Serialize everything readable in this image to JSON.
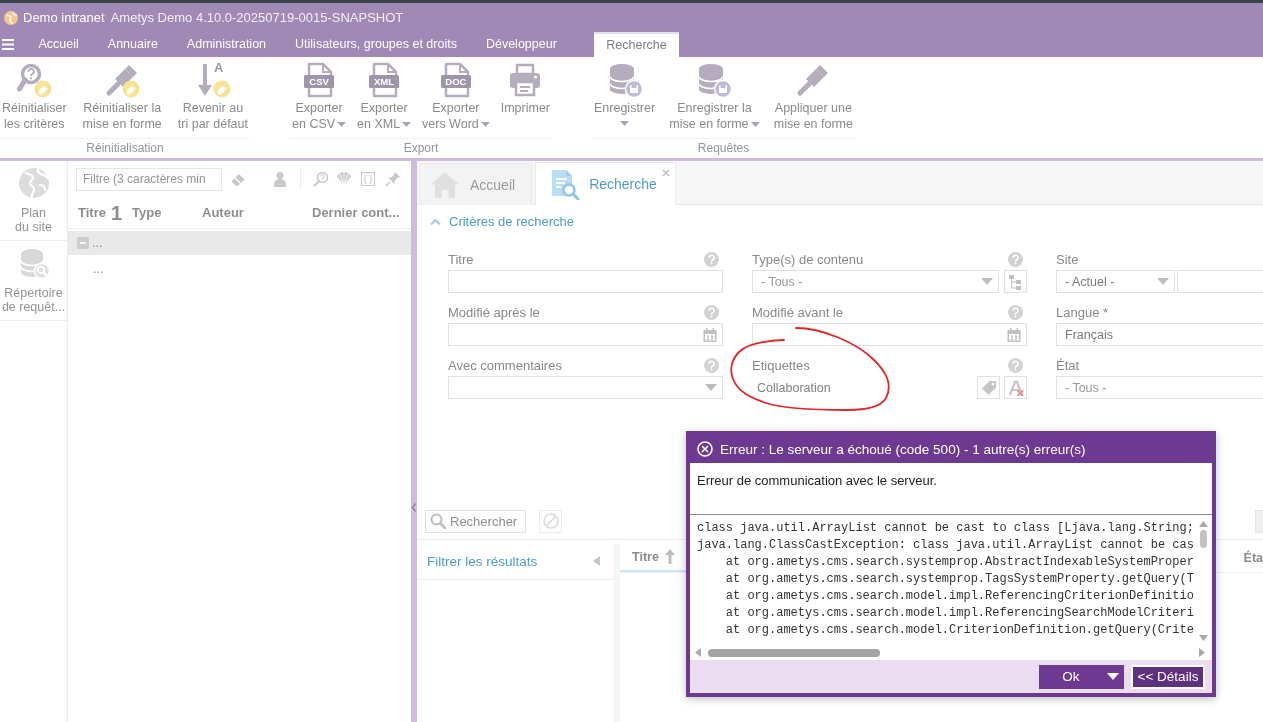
{
  "window": {
    "app_name": "Demo intranet",
    "version": "Ametys Demo 4.10.0-20250719-0015-SNAPSHOT"
  },
  "menu_tabs": [
    {
      "label": "Accueil",
      "kind": "standard",
      "selected": false
    },
    {
      "label": "Annuaire",
      "kind": "standard",
      "selected": false
    },
    {
      "label": "Administration",
      "kind": "standard",
      "selected": false
    },
    {
      "label": "Utilisateurs, groupes et droits",
      "kind": "standard",
      "selected": false
    },
    {
      "label": "Développeur",
      "kind": "standard",
      "selected": false
    },
    {
      "label": "Recherche",
      "kind": "contextual",
      "selected": true
    }
  ],
  "ribbon": {
    "groups": [
      {
        "label": "Réinitialisation",
        "buttons": [
          {
            "label": "Réinitialiser\nles critères",
            "dropdown": false
          },
          {
            "label": "Réinitialiser la\nmise en forme",
            "dropdown": false
          },
          {
            "label": "Revenir au\ntri par défaut",
            "icon_text": "A",
            "dropdown": false
          }
        ]
      },
      {
        "label": "Export",
        "buttons": [
          {
            "label": "Exporter\nen CSV",
            "icon_text": "CSV",
            "dropdown": true
          },
          {
            "label": "Exporter\nen XML",
            "icon_text": "XML",
            "dropdown": true
          },
          {
            "label": "Exporter\nvers Word",
            "icon_text": "DOC",
            "dropdown": true
          },
          {
            "label": "Imprimer",
            "dropdown": false
          }
        ]
      },
      {
        "label": "Requêtes",
        "buttons": [
          {
            "label": "Enregistrer",
            "dropdown": true
          },
          {
            "label": "Enregistrer la\nmise en forme",
            "dropdown": true
          },
          {
            "label": "Appliquer une\nmise en forme",
            "dropdown": false
          }
        ]
      }
    ]
  },
  "sidebar": {
    "items": [
      {
        "label": "Plan\ndu site"
      },
      {
        "label": "Répertoire\nde requêt..."
      }
    ]
  },
  "tree_panel": {
    "filter": {
      "placeholder": "Filtre (3 caractères min"
    },
    "columns": [
      {
        "label": "Titre",
        "sort_mark": "1"
      },
      {
        "label": "Type"
      },
      {
        "label": "Auteur"
      },
      {
        "label": "Dernier cont..."
      }
    ],
    "rows": [
      {
        "label": "...",
        "selected": true,
        "expanded": true,
        "children": [
          {
            "label": "...",
            "selected": false
          }
        ]
      }
    ]
  },
  "search_tool": {
    "tabs": [
      {
        "label": "Accueil",
        "selected": false,
        "closable": false
      },
      {
        "label": "Recherche",
        "selected": true,
        "closable": true
      }
    ],
    "criteria": {
      "title": "Critères de recherche",
      "expanded": true,
      "fields": [
        {
          "label": "Titre",
          "kind": "text",
          "help": true
        },
        {
          "label": "Type(s) de contenu",
          "kind": "combo-tree",
          "placeholder": "- Tous -",
          "help": true
        },
        {
          "label": "Site",
          "kind": "combo-extra",
          "value": "- Actuel -",
          "help": false
        },
        {
          "label": "Modifié après le",
          "kind": "date",
          "help": true
        },
        {
          "label": "Modifié avant le",
          "kind": "date",
          "help": true
        },
        {
          "label": "Langue *",
          "kind": "text",
          "value": "Français",
          "help": false
        },
        {
          "label": "Avec commentaires",
          "kind": "combo",
          "help": true
        },
        {
          "label": "Etiquettes",
          "kind": "tags",
          "value": "Collaboration",
          "help": true
        },
        {
          "label": "État",
          "kind": "text",
          "placeholder": "- Tous -",
          "help": false
        }
      ]
    },
    "annotation": {
      "kind": "ellipse"
    },
    "toolbar": {
      "search_button": "Rechercher",
      "cancel_disabled": true
    },
    "results": {
      "filter_panel": {
        "title": "Filtrer les résultats"
      },
      "columns": [
        {
          "label": "Titre",
          "sorted": true
        },
        {
          "label": "Éta",
          "sorted": false
        }
      ]
    }
  },
  "dialog": {
    "title": "Erreur : Le serveur a échoué (code 500) - 1 autre(s) erreur(s)",
    "message": "Erreur de communication avec le serveur.",
    "details": [
      {
        "kind": "message",
        "text": "class java.util.ArrayList cannot be cast to class [Ljava.lang.String;"
      },
      {
        "kind": "message",
        "text": "java.lang.ClassCastException: class java.util.ArrayList cannot be cas"
      },
      {
        "kind": "frame",
        "text": "at org.ametys.cms.search.systemprop.AbstractIndexableSystemProper"
      },
      {
        "kind": "frame",
        "text": "at org.ametys.cms.search.systemprop.TagsSystemProperty.getQuery(T"
      },
      {
        "kind": "frame",
        "text": "at org.ametys.cms.search.model.impl.ReferencingCriterionDefinitio"
      },
      {
        "kind": "frame",
        "text": "at org.ametys.cms.search.model.impl.ReferencingSearchModelCriteri"
      },
      {
        "kind": "frame",
        "text": "at org.ametys.cms.search.model.CriterionDefinition.getQuery(Crite"
      }
    ],
    "buttons": [
      {
        "label": "Ok",
        "kind": "split",
        "focused": false
      },
      {
        "label": "<< Détails",
        "kind": "plain",
        "focused": true
      }
    ]
  }
}
